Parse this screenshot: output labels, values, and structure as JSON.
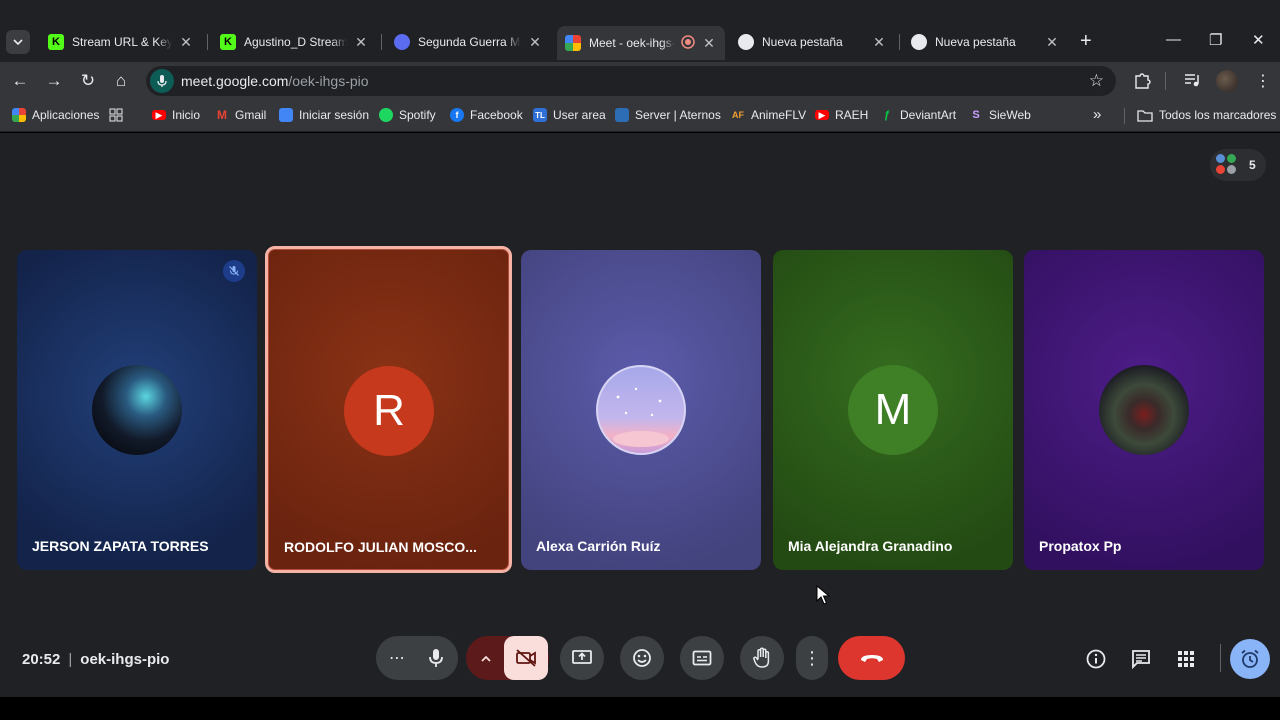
{
  "browser": {
    "tabs": [
      {
        "title": "Stream URL & Key - K",
        "favicon": "kick-icon",
        "active": false
      },
      {
        "title": "Agustino_D Stream - ",
        "favicon": "kick-icon",
        "active": false
      },
      {
        "title": "Segunda Guerra Mun",
        "favicon": "shield-icon",
        "active": false
      },
      {
        "title": "Meet - oek-ihgs-pio",
        "favicon": "meet-icon",
        "active": true
      },
      {
        "title": "Nueva pestaña",
        "favicon": "chrome-icon",
        "active": false
      },
      {
        "title": "Nueva pestaña",
        "favicon": "chrome-icon",
        "active": false
      }
    ],
    "url_host": "meet.google.com",
    "url_path": "/oek-ihgs-pio",
    "bookmarks": [
      {
        "label": "Aplicaciones",
        "icon": "apps-grid-icon"
      },
      {
        "label": "",
        "icon": "grid-icon"
      },
      {
        "label": "Inicio",
        "icon": "youtube-icon"
      },
      {
        "label": "Gmail",
        "icon": "gmail-icon"
      },
      {
        "label": "Iniciar sesión",
        "icon": "login-icon"
      },
      {
        "label": "Spotify",
        "icon": "spotify-icon"
      },
      {
        "label": "Facebook",
        "icon": "facebook-icon"
      },
      {
        "label": "User area",
        "icon": "tl-icon"
      },
      {
        "label": "Server | Aternos",
        "icon": "aternos-icon"
      },
      {
        "label": "AnimeFLV",
        "icon": "animeflv-icon"
      },
      {
        "label": "RAEH",
        "icon": "youtube-icon"
      },
      {
        "label": "DeviantArt",
        "icon": "deviantart-icon"
      },
      {
        "label": "SieWeb",
        "icon": "sieweb-icon"
      }
    ],
    "bookmarks_overflow": "»",
    "all_bookmarks_label": "Todos los marcadores"
  },
  "meet": {
    "participant_count": "5",
    "participants": [
      {
        "name": "JERSON ZAPATA TORRES",
        "initial": "",
        "avatar": "photo-avatar",
        "muted": true,
        "speaking": false,
        "bg": "#1b2f5c"
      },
      {
        "name": "RODOLFO JULIAN MOSCO...",
        "initial": "R",
        "avatar": "letter-avatar",
        "muted": false,
        "speaking": true,
        "bg": "#7a2a14"
      },
      {
        "name": "Alexa Carrión Ruíz",
        "initial": "",
        "avatar": "photo-avatar",
        "muted": false,
        "speaking": false,
        "bg": "#4a4a8c"
      },
      {
        "name": "Mia Alejandra Granadino",
        "initial": "M",
        "avatar": "letter-avatar",
        "muted": false,
        "speaking": false,
        "bg": "#2d5a1a"
      },
      {
        "name": "Propatox Pp",
        "initial": "",
        "avatar": "photo-avatar",
        "muted": false,
        "speaking": false,
        "bg": "#3d1670"
      }
    ],
    "time": "20:52",
    "meeting_code": "oek-ihgs-pio",
    "colors": {
      "end_call": "#dc362e",
      "camera_off": "#f9dedc",
      "accent": "#8ab4f8"
    }
  }
}
